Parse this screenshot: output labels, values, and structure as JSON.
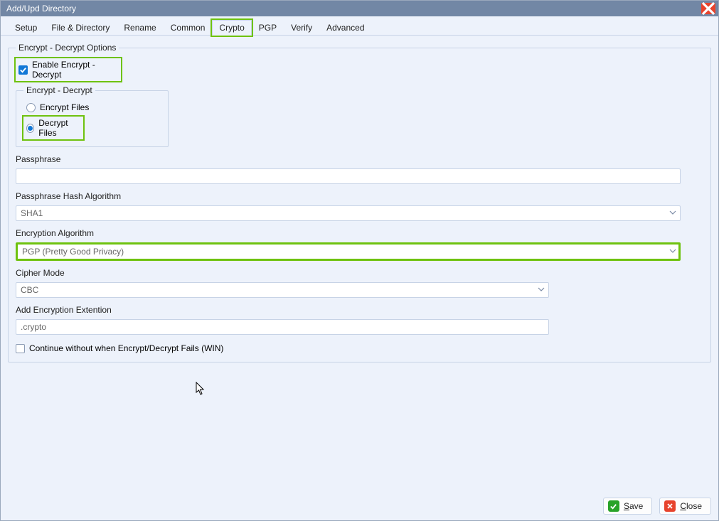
{
  "window": {
    "title": "Add/Upd Directory"
  },
  "tabs": {
    "items": [
      "Setup",
      "File & Directory",
      "Rename",
      "Common",
      "Crypto",
      "PGP",
      "Verify",
      "Advanced"
    ],
    "active": "Crypto"
  },
  "group": {
    "title": "Encrypt - Decrypt Options",
    "enable_label": "Enable Encrypt - Decrypt",
    "enable_checked": true,
    "radio_group_title": "Encrypt - Decrypt",
    "radio_encrypt": "Encrypt Files",
    "radio_decrypt": "Decrypt Files",
    "radio_selected": "decrypt",
    "passphrase_label": "Passphrase",
    "passphrase_value": "",
    "hash_label": "Passphrase Hash Algorithm",
    "hash_value": "SHA1",
    "enc_algo_label": "Encryption Algorithm",
    "enc_algo_value": "PGP (Pretty Good Privacy)",
    "cipher_label": "Cipher Mode",
    "cipher_value": "CBC",
    "ext_label": "Add Encryption Extention",
    "ext_value": ".crypto",
    "continue_label": "Continue without when Encrypt/Decrypt Fails (WIN)",
    "continue_checked": false
  },
  "footer": {
    "save": "Save",
    "close": "Close"
  }
}
